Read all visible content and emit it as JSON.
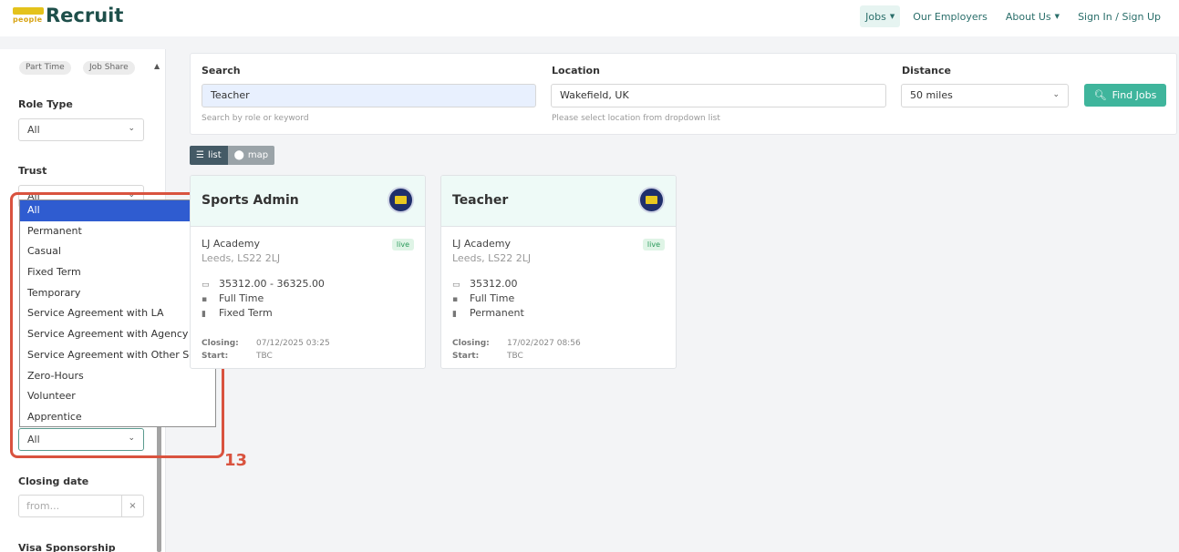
{
  "header": {
    "logo_small": "people",
    "logo_word": "Recruit",
    "nav": [
      {
        "label": "Jobs",
        "caret": true
      },
      {
        "label": "Our Employers",
        "caret": false
      },
      {
        "label": "About Us",
        "caret": true
      },
      {
        "label": "Sign In / Sign Up",
        "caret": false
      }
    ]
  },
  "sidebar": {
    "pills": [
      "Part Time",
      "Job Share"
    ],
    "role_type": {
      "label": "Role Type",
      "value": "All"
    },
    "trust": {
      "label": "Trust",
      "value": "All"
    },
    "contract_select_value": "All",
    "closing_date": {
      "label": "Closing date",
      "placeholder": "from...",
      "clear": "×"
    },
    "visa_label": "Visa Sponsorship"
  },
  "dropdown": {
    "options": [
      "All",
      "Permanent",
      "Casual",
      "Fixed Term",
      "Temporary",
      "Service Agreement with LA",
      "Service Agreement with Agency",
      "Service Agreement with Other Source",
      "Zero-Hours",
      "Volunteer",
      "Apprentice"
    ],
    "selected_index": 0
  },
  "annotation": {
    "number": "13",
    "color": "#d9533f"
  },
  "search": {
    "search_label": "Search",
    "search_value": "Teacher",
    "search_hint": "Search by role or keyword",
    "location_label": "Location",
    "location_value": "Wakefield, UK",
    "location_hint": "Please select location from dropdown list",
    "distance_label": "Distance",
    "distance_value": "50 miles",
    "find_button": "Find Jobs"
  },
  "view_toggle": {
    "list": "list",
    "map": "map"
  },
  "cards": [
    {
      "title": "Sports Admin",
      "employer": "LJ Academy",
      "location": "Leeds, LS22 2LJ",
      "status": "live",
      "salary": "35312.00 - 36325.00",
      "hours": "Full Time",
      "contract": "Fixed Term",
      "closing_label": "Closing:",
      "closing_value": "07/12/2025 03:25",
      "start_label": "Start:",
      "start_value": "TBC"
    },
    {
      "title": "Teacher",
      "employer": "LJ Academy",
      "location": "Leeds, LS22 2LJ",
      "status": "live",
      "salary": "35312.00",
      "hours": "Full Time",
      "contract": "Permanent",
      "closing_label": "Closing:",
      "closing_value": "17/02/2027 08:56",
      "start_label": "Start:",
      "start_value": "TBC"
    }
  ]
}
